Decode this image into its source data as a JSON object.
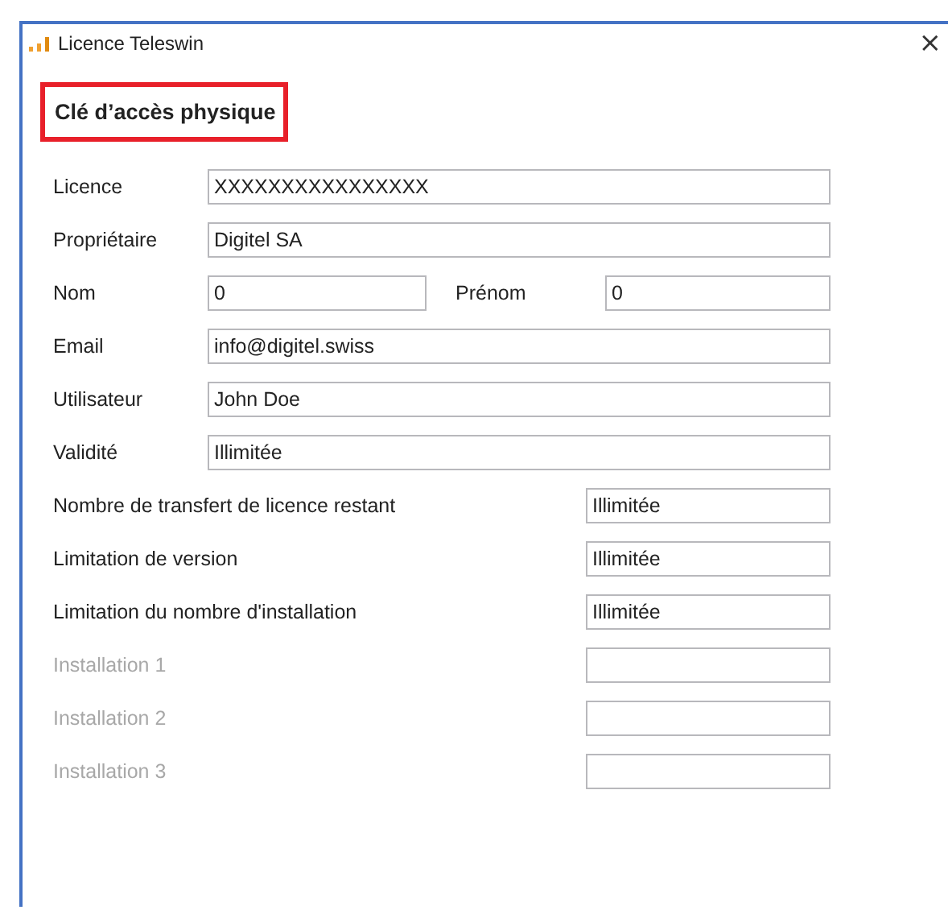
{
  "window": {
    "title": "Licence Teleswin",
    "close": "×"
  },
  "section": {
    "title": "Clé d’accès physique",
    "highlighted": true
  },
  "rows": [
    {
      "kind": "wide",
      "label": "Licence",
      "value": "XXXXXXXXXXXXXXXX",
      "disabled": false
    },
    {
      "kind": "wide",
      "label": "Propriétaire",
      "value": "Digitel SA",
      "disabled": false
    },
    {
      "kind": "pair",
      "label": "Nom",
      "value": "0",
      "label_2": "Prénom",
      "value_2": "0",
      "disabled": false
    },
    {
      "kind": "wide",
      "label": "Email",
      "value": "info@digitel.swiss",
      "disabled": false
    },
    {
      "kind": "wide",
      "label": "Utilisateur",
      "value": "John Doe",
      "disabled": false
    },
    {
      "kind": "wide",
      "label": "Validité",
      "value": "Illimitée",
      "disabled": false
    },
    {
      "kind": "short",
      "label": "Nombre de transfert de licence restant",
      "value": "Illimitée",
      "disabled": false
    },
    {
      "kind": "short",
      "label": "Limitation de version",
      "value": "Illimitée",
      "disabled": false
    },
    {
      "kind": "short",
      "label": "Limitation du nombre d'installation",
      "value": "Illimitée",
      "disabled": false
    },
    {
      "kind": "short",
      "label": "Installation 1",
      "disabled": true
    },
    {
      "kind": "short",
      "label": "Installation 2",
      "disabled": true
    },
    {
      "kind": "short",
      "label": "Installation 3",
      "disabled": true
    }
  ]
}
